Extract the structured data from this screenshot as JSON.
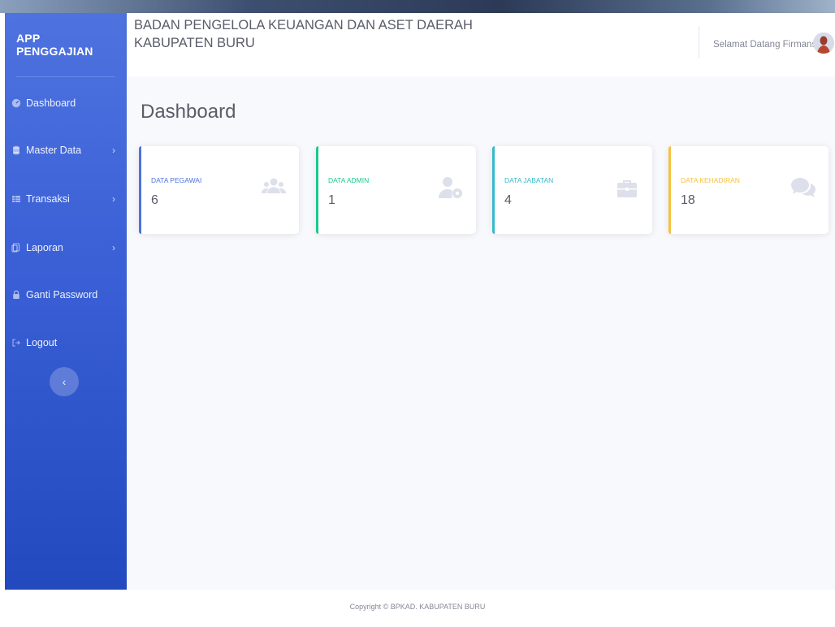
{
  "app": {
    "brand": "APP PENGGAJIAN"
  },
  "sidebar": {
    "items": [
      {
        "label": "Dashboard",
        "icon": "tachometer-icon",
        "has_chevron": false
      },
      {
        "label": "Master Data",
        "icon": "database-icon",
        "has_chevron": true
      },
      {
        "label": "Transaksi",
        "icon": "table-icon",
        "has_chevron": true
      },
      {
        "label": "Laporan",
        "icon": "copy-icon",
        "has_chevron": true
      },
      {
        "label": "Ganti Password",
        "icon": "lock-icon",
        "has_chevron": false
      },
      {
        "label": "Logout",
        "icon": "sign-out-icon",
        "has_chevron": false
      }
    ],
    "chevron": "›",
    "toggle": "‹"
  },
  "topbar": {
    "title": "BADAN PENGELOLA KEUANGAN DAN ASET DAERAH KABUPATEN BURU",
    "welcome": "Selamat Datang Firmansyah"
  },
  "main": {
    "page_title": "Dashboard",
    "cards": [
      {
        "label": "DATA PEGAWAI",
        "value": "6",
        "color": "#4e73df",
        "icon": "users-icon"
      },
      {
        "label": "DATA ADMIN",
        "value": "1",
        "color": "#1cc88a",
        "icon": "user-cog-icon"
      },
      {
        "label": "DATA JABATAN",
        "value": "4",
        "color": "#36b9cc",
        "icon": "briefcase-icon"
      },
      {
        "label": "DATA KEHADIRAN",
        "value": "18",
        "color": "#f6c23e",
        "icon": "comments-icon"
      }
    ]
  },
  "footer": {
    "text": "Copyright © BPKAD. KABUPATEN BURU"
  }
}
